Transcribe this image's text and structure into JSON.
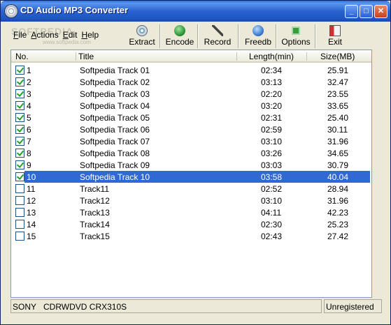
{
  "window": {
    "title": "CD Audio MP3 Converter"
  },
  "title_buttons": {
    "minimize": "_",
    "maximize": "□",
    "close": "✕"
  },
  "watermark": {
    "line1": "SOFTPEDIA",
    "line2": "www.softpedia.com"
  },
  "menu": [
    {
      "label": "File",
      "access": "F"
    },
    {
      "label": "Actions",
      "access": "A"
    },
    {
      "label": "Edit",
      "access": "E"
    },
    {
      "label": "Help",
      "access": "H"
    }
  ],
  "toolbar": [
    {
      "label": "Extract",
      "icon": "extract-icon"
    },
    {
      "label": "Encode",
      "icon": "encode-icon"
    },
    {
      "label": "Record",
      "icon": "record-icon"
    },
    {
      "label": "Freedb",
      "icon": "freedb-icon"
    },
    {
      "label": "Options",
      "icon": "options-icon"
    },
    {
      "label": "Exit",
      "icon": "exit-icon"
    }
  ],
  "columns": {
    "no": "No.",
    "title": "Title",
    "length": "Length(min)",
    "size": "Size(MB)"
  },
  "tracks": [
    {
      "no": "1",
      "title": "Softpedia Track 01",
      "length": "02:34",
      "size": "25.91",
      "checked": true
    },
    {
      "no": "2",
      "title": "Softpedia Track 02",
      "length": "03:13",
      "size": "32.47",
      "checked": true
    },
    {
      "no": "3",
      "title": "Softpedia Track 03",
      "length": "02:20",
      "size": "23.55",
      "checked": true
    },
    {
      "no": "4",
      "title": "Softpedia Track 04",
      "length": "03:20",
      "size": "33.65",
      "checked": true
    },
    {
      "no": "5",
      "title": "Softpedia Track 05",
      "length": "02:31",
      "size": "25.40",
      "checked": true
    },
    {
      "no": "6",
      "title": "Softpedia Track 06",
      "length": "02:59",
      "size": "30.11",
      "checked": true
    },
    {
      "no": "7",
      "title": "Softpedia Track 07",
      "length": "03:10",
      "size": "31.96",
      "checked": true
    },
    {
      "no": "8",
      "title": "Softpedia Track 08",
      "length": "03:26",
      "size": "34.65",
      "checked": true
    },
    {
      "no": "9",
      "title": "Softpedia Track 09",
      "length": "03:03",
      "size": "30.79",
      "checked": true
    },
    {
      "no": "10",
      "title": "Softpedia Track 10",
      "length": "03:58",
      "size": "40.04",
      "checked": true,
      "selected": true
    },
    {
      "no": "11",
      "title": "Track11",
      "length": "02:52",
      "size": "28.94",
      "checked": false
    },
    {
      "no": "12",
      "title": "Track12",
      "length": "03:10",
      "size": "31.96",
      "checked": false
    },
    {
      "no": "13",
      "title": "Track13",
      "length": "04:11",
      "size": "42.23",
      "checked": false
    },
    {
      "no": "14",
      "title": "Track14",
      "length": "02:30",
      "size": "25.23",
      "checked": false
    },
    {
      "no": "15",
      "title": "Track15",
      "length": "02:43",
      "size": "27.42",
      "checked": false
    }
  ],
  "status": {
    "drive_vendor": "SONY",
    "drive_model": "CDRWDVD CRX310S",
    "registration": "Unregistered"
  },
  "colors": {
    "selection": "#3168d5",
    "titlebar": "#2a63d1",
    "window_bg": "#ece9d8"
  }
}
